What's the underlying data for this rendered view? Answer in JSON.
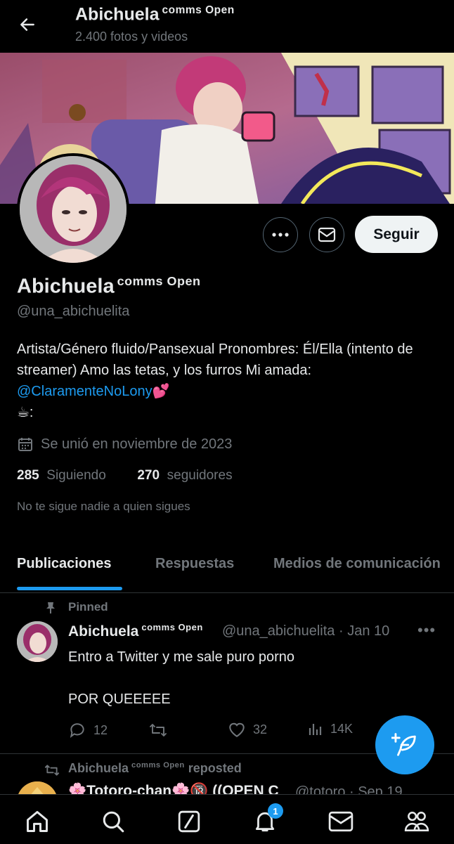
{
  "header": {
    "name": "Abichuela",
    "name_tag": "comms Open",
    "post_count": "2.400 fotos y videos"
  },
  "profile": {
    "name": "Abichuela",
    "name_tag": "comms Open",
    "handle": "@una_abichuelita",
    "follow_label": "Seguir",
    "bio_text": "Artista/Género fluido/Pansexual Pronombres: Él/Ella (intento de streamer) Amo las tetas, y los furros Mi amada: ",
    "bio_link": "@ClaramenteNoLony",
    "bio_emoji": "💕",
    "bio_line2": "☕:",
    "joined": "Se unió en noviembre de 2023",
    "following_count": "285",
    "following_label": "Siguiendo",
    "followers_count": "270",
    "followers_label": "seguidores",
    "no_follow_note": "No te sigue nadie a quien sigues"
  },
  "tabs": [
    {
      "label": "Publicaciones"
    },
    {
      "label": "Respuestas"
    },
    {
      "label": "Medios de comunicación"
    }
  ],
  "pinned_post": {
    "pinned_label": "Pinned",
    "author": "Abichuela",
    "author_tag": "comms Open",
    "handle_date": "@una_abichuelita · Jan 10",
    "text": "Entro a Twitter y me sale puro porno\n\nPOR QUEEEEE",
    "replies": "12",
    "likes": "32",
    "views": "14K"
  },
  "repost": {
    "reposter": "Abichuela",
    "reposter_tag": "comms Open",
    "repost_label": "reposted",
    "author": "🌸Totoro-chan🌸🔞 ((OPEN C",
    "handle_date": "@totoro · Sep 19"
  },
  "bottom_nav": {
    "notifications_badge": "1"
  },
  "colors": {
    "accent": "#1d9bf0",
    "background": "#000000",
    "muted": "#71767b"
  }
}
